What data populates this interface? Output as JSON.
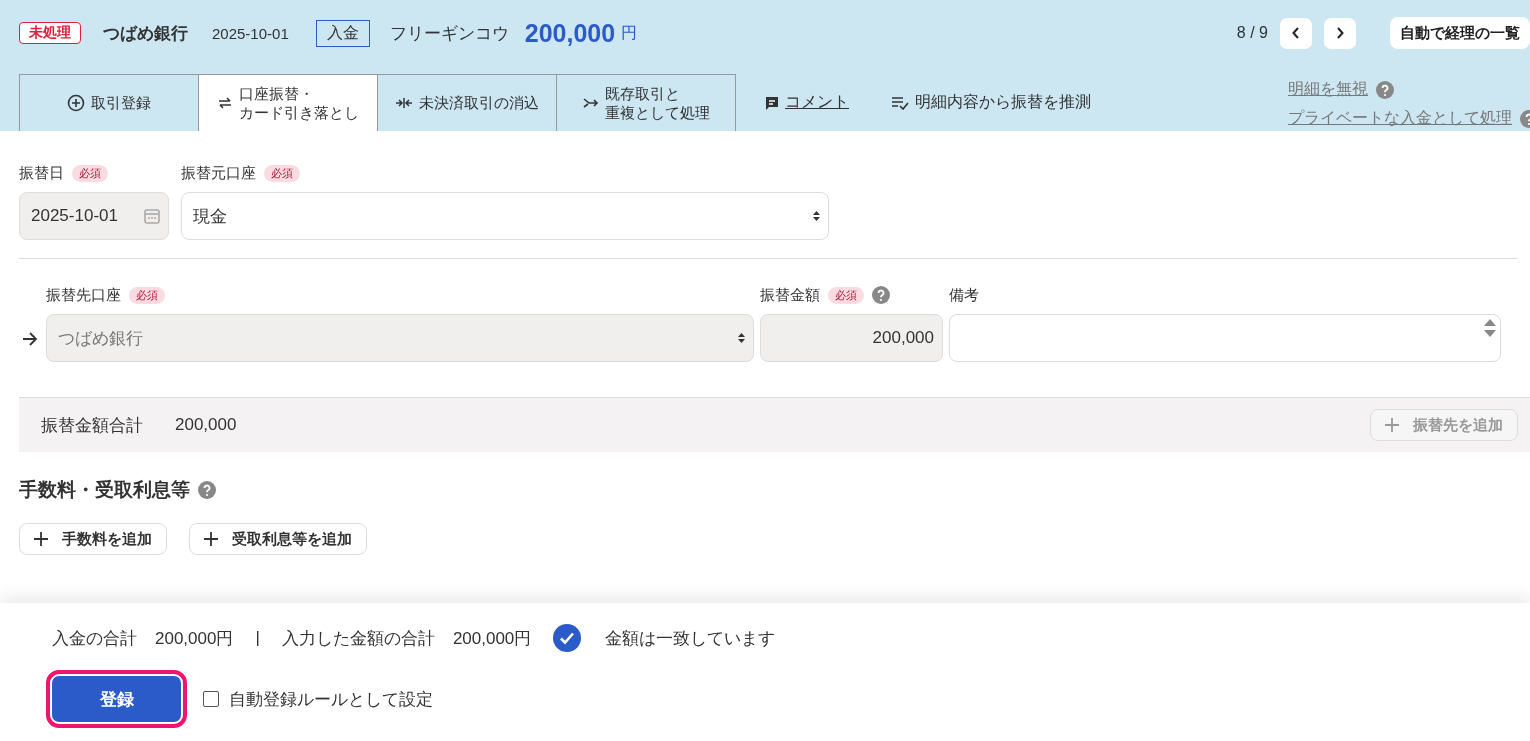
{
  "header": {
    "status_badge": "未処理",
    "bank": "つばめ銀行",
    "date": "2025-10-01",
    "type_badge": "入金",
    "description": "フリーギンコウ",
    "amount": "200,000",
    "currency": "円",
    "pager": "8 / 9",
    "list_button": "自動で経理の一覧"
  },
  "tabs": [
    {
      "lines": [
        "取引登録"
      ],
      "selected": false
    },
    {
      "lines": [
        "口座振替・",
        "カード引き落とし"
      ],
      "selected": true
    },
    {
      "lines": [
        "未決済取引の消込"
      ],
      "selected": false
    },
    {
      "lines": [
        "既存取引と",
        "重複として処理"
      ],
      "selected": false
    }
  ],
  "tab_links": [
    {
      "label": "コメント",
      "kind": "comment"
    },
    {
      "label": "明細内容から振替を推測",
      "kind": "guess"
    }
  ],
  "side_links": [
    "明細を無視",
    "プライベートな入金として処理"
  ],
  "source": {
    "date": {
      "label": "振替日",
      "required": "必須",
      "value": "2025-10-01",
      "disabled": true
    },
    "account": {
      "label": "振替元口座",
      "required": "必須",
      "value": "現金",
      "disabled": false
    }
  },
  "destination": {
    "account": {
      "label": "振替先口座",
      "required": "必須",
      "value": "つばめ銀行",
      "disabled": true
    },
    "amount": {
      "label": "振替金額",
      "required": "必須",
      "value": "200,000",
      "disabled": true
    },
    "memo": {
      "label": "備考"
    }
  },
  "total": {
    "label": "振替金額合計",
    "value": "200,000",
    "add_button": "振替先を追加",
    "add_disabled": true
  },
  "fees": {
    "title": "手数料・受取利息等",
    "buttons": [
      "手数料を追加",
      "受取利息等を追加"
    ]
  },
  "footer": {
    "summary": [
      {
        "label": "入金の合計",
        "value": "200,000円"
      },
      {
        "label": "入力した金額の合計",
        "value": "200,000円"
      }
    ],
    "separator": "|",
    "matched": true,
    "match_text": "金額は一致しています",
    "register": "登録",
    "auto_rule": {
      "label": "自動登録ルールとして設定",
      "checked": false
    }
  }
}
